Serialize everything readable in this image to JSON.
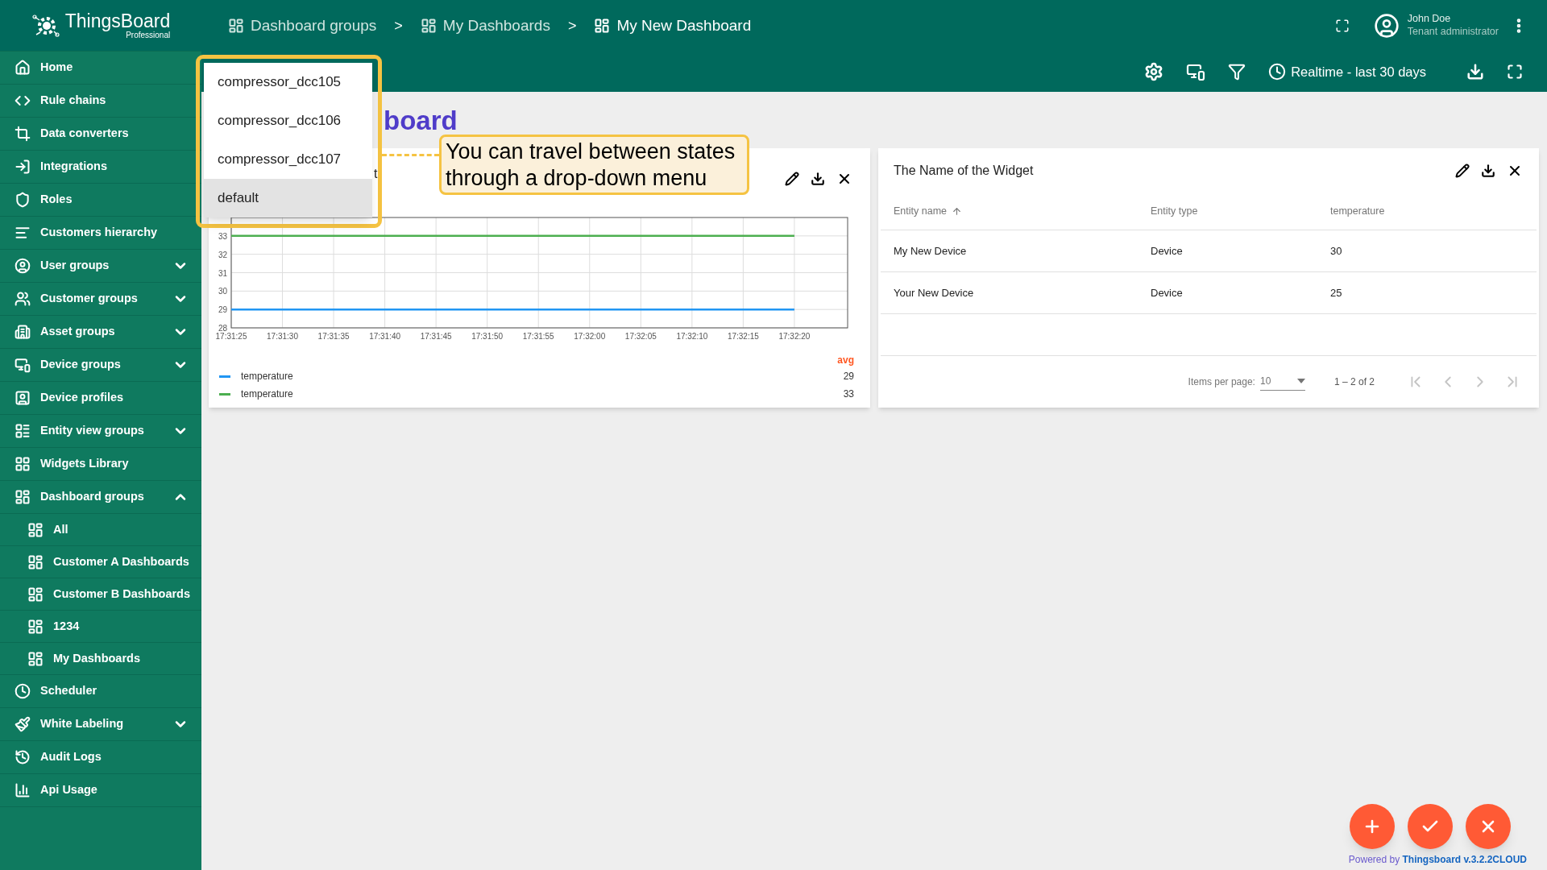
{
  "logo": {
    "name": "ThingsBoard",
    "edition": "Professional"
  },
  "sidebar": {
    "items": [
      {
        "label": "Home"
      },
      {
        "label": "Rule chains"
      },
      {
        "label": "Data converters"
      },
      {
        "label": "Integrations"
      },
      {
        "label": "Roles"
      },
      {
        "label": "Customers hierarchy"
      },
      {
        "label": "User groups",
        "expanded": false
      },
      {
        "label": "Customer groups",
        "expanded": false
      },
      {
        "label": "Asset groups",
        "expanded": false
      },
      {
        "label": "Device groups",
        "expanded": false
      },
      {
        "label": "Device profiles"
      },
      {
        "label": "Entity view groups",
        "expanded": false
      },
      {
        "label": "Widgets Library"
      },
      {
        "label": "Dashboard groups",
        "expanded": true,
        "children": [
          {
            "label": "All"
          },
          {
            "label": "Customer A Dashboards"
          },
          {
            "label": "Customer B Dashboards"
          },
          {
            "label": "1234"
          },
          {
            "label": "My Dashboards"
          }
        ]
      },
      {
        "label": "Scheduler"
      },
      {
        "label": "White Labeling",
        "expanded": false
      },
      {
        "label": "Audit Logs"
      },
      {
        "label": "Api Usage"
      }
    ]
  },
  "breadcrumbs": [
    {
      "label": "Dashboard groups",
      "selected": false
    },
    {
      "label": ">",
      "kind": "separator"
    },
    {
      "label": "My Dashboards",
      "selected": false
    },
    {
      "label": ">",
      "kind": "separator"
    },
    {
      "label": "My New Dashboard",
      "selected": true
    }
  ],
  "user": {
    "name": "John Doe",
    "role": "Tenant administrator"
  },
  "toolbar": {
    "timewindow": "Realtime - last 30 days"
  },
  "dashboard": {
    "title": "board"
  },
  "state_dropdown": {
    "items": [
      {
        "label": "compressor_dcc105",
        "selected": false
      },
      {
        "label": "compressor_dcc106",
        "selected": false
      },
      {
        "label": "compressor_dcc107",
        "selected": false
      },
      {
        "label": "default",
        "selected": true
      }
    ]
  },
  "callout": {
    "text": "You can travel between states through a drop-down menu"
  },
  "chart_widget": {
    "title": "t",
    "chart_data": {
      "type": "line",
      "categories": [
        "17:31:25",
        "17:31:30",
        "17:31:35",
        "17:31:40",
        "17:31:45",
        "17:31:50",
        "17:31:55",
        "17:32:00",
        "17:32:05",
        "17:32:10",
        "17:32:15",
        "17:32:20"
      ],
      "ylim": [
        28,
        34
      ],
      "grid": true,
      "yticks": [
        28,
        29,
        30,
        31,
        32,
        33
      ],
      "series": [
        {
          "name": "temperature",
          "color": "#2196f3",
          "values": [
            29,
            29,
            29,
            29,
            29,
            29,
            29,
            29,
            29,
            29,
            29,
            29
          ]
        },
        {
          "name": "temperature",
          "color": "#4caf50",
          "values": [
            33,
            33,
            33,
            33,
            33,
            33,
            33,
            33,
            33,
            33,
            33,
            33
          ]
        }
      ]
    },
    "legend": {
      "header": "avg",
      "values": [
        "29",
        "33"
      ]
    }
  },
  "table_widget": {
    "title": "The Name of the Widget",
    "columns": [
      {
        "label": "Entity name",
        "sorted": true
      },
      {
        "label": "Entity type",
        "sorted": false
      },
      {
        "label": "temperature",
        "sorted": false
      }
    ],
    "rows": [
      [
        "My New Device",
        "Device",
        "30"
      ],
      [
        "Your New Device",
        "Device",
        "25"
      ]
    ],
    "paginator": {
      "label": "Items per page:",
      "page_size": "10",
      "range": "1 – 2 of 2",
      "nav_disabled": true
    }
  },
  "footer": {
    "prefix": "Powered by",
    "link": "Thingsboard v.3.2.2CLOUD"
  }
}
